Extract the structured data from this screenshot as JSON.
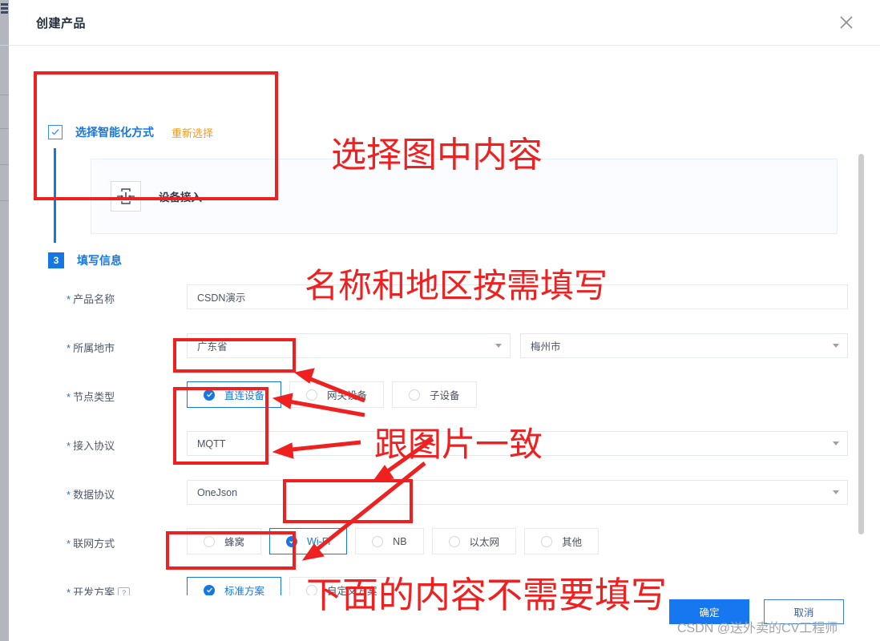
{
  "dialog": {
    "title": "创建产品",
    "close_icon": "close-icon"
  },
  "steps": {
    "method_step": {
      "label": "选择智能化方式",
      "relink": "重新选择",
      "checked": true
    },
    "info_step": {
      "badge": "3",
      "label": "填写信息"
    }
  },
  "method_card": {
    "icon": "device-access-icon",
    "name": "设备接入"
  },
  "form": {
    "product_name": {
      "label": "产品名称",
      "required": "*",
      "value": "CSDN演示"
    },
    "region": {
      "label": "所属地市",
      "required": "*",
      "province": "广东省",
      "city": "梅州市"
    },
    "node_type": {
      "label": "节点类型",
      "required": "*",
      "options": [
        {
          "label": "直连设备",
          "selected": true
        },
        {
          "label": "网关设备",
          "selected": false
        },
        {
          "label": "子设备",
          "selected": false
        }
      ]
    },
    "access_protocol": {
      "label": "接入协议",
      "required": "*",
      "value": "MQTT"
    },
    "data_protocol": {
      "label": "数据协议",
      "required": "*",
      "value": "OneJson"
    },
    "network_type": {
      "label": "联网方式",
      "required": "*",
      "options": [
        {
          "label": "蜂窝",
          "selected": false
        },
        {
          "label": "Wi-Fi",
          "selected": true
        },
        {
          "label": "NB",
          "selected": false
        },
        {
          "label": "以太网",
          "selected": false
        },
        {
          "label": "其他",
          "selected": false
        }
      ]
    },
    "dev_plan": {
      "label": "开发方案",
      "required": "*",
      "help": "?",
      "options": [
        {
          "label": "标准方案",
          "selected": true
        },
        {
          "label": "自定义方案",
          "selected": false
        }
      ]
    }
  },
  "footer": {
    "confirm": "确定",
    "cancel": "取消"
  },
  "watermark": "CSDN @送外卖的CV工程师",
  "annotations": {
    "color": "#ef2020",
    "notes": [
      "选择图中内容",
      "名称和地区按需填写",
      "跟图片一致",
      "下面的内容不需要填写"
    ]
  }
}
